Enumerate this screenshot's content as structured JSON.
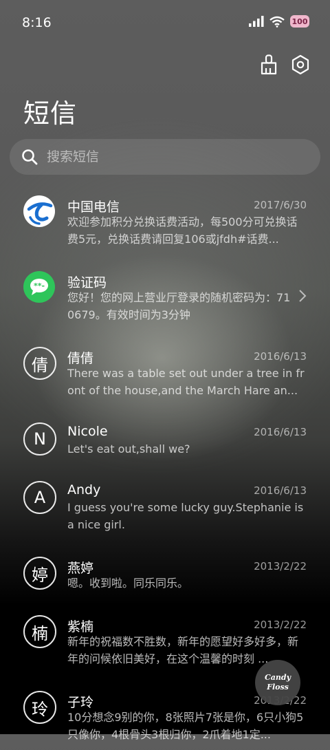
{
  "status": {
    "time": "8:16",
    "battery": "100"
  },
  "header": {
    "title": "短信"
  },
  "search": {
    "placeholder": "搜索短信"
  },
  "threads": [
    {
      "name": "中国电信",
      "date": "2017/6/30",
      "preview": "欢迎参加积分兑换话费活动，每500分可兑换话费5元，兑换话费请回复106或jfdh#话费...",
      "avatar_type": "telecom-logo",
      "avatar_text": ""
    },
    {
      "name": "验证码",
      "date": "",
      "preview": "您好！您的网上营业厅登录的随机密码为：710679。有效时间为3分钟",
      "avatar_type": "message-code",
      "avatar_text": ""
    },
    {
      "name": "倩倩",
      "date": "2016/6/13",
      "preview": "There was a table set out under a tree in front of the house,and the March Hare an...",
      "avatar_type": "letter",
      "avatar_text": "倩"
    },
    {
      "name": "Nicole",
      "date": "2016/6/13",
      "preview": "Let's eat out,shall we?",
      "avatar_type": "letter",
      "avatar_text": "N"
    },
    {
      "name": "Andy",
      "date": "2016/6/13",
      "preview": "I guess you're some lucky guy.Stephanie is a nice girl.",
      "avatar_type": "letter",
      "avatar_text": "A"
    },
    {
      "name": "燕婷",
      "date": "2013/2/22",
      "preview": "嗯。收到啦。同乐同乐。",
      "avatar_type": "letter",
      "avatar_text": "婷"
    },
    {
      "name": "紫楠",
      "date": "2013/2/22",
      "preview": "新年的祝福数不胜数，新年的愿望好多好多，新年的问候依旧美好，在这个温馨的时刻 ...",
      "avatar_type": "letter",
      "avatar_text": "楠"
    },
    {
      "name": "子玲",
      "date": "2013/2/22",
      "preview": "10分想念9别的你，8张照片7张是你，6只小狗5只像你，4根骨头3根归你，2爪着地1定...",
      "avatar_type": "letter",
      "avatar_text": "玲"
    }
  ],
  "floating_badge": {
    "line1": "Candy",
    "line2": "Floss"
  },
  "colors": {
    "code_avatar": "#2ec55a",
    "telecom_blue": "#1a6fd0",
    "battery": "#f0b7cc"
  },
  "icons": [
    "cleanup-brush-icon",
    "settings-hexagon-icon",
    "search-icon",
    "chevron-right-icon",
    "signal-icon",
    "wifi-icon"
  ]
}
